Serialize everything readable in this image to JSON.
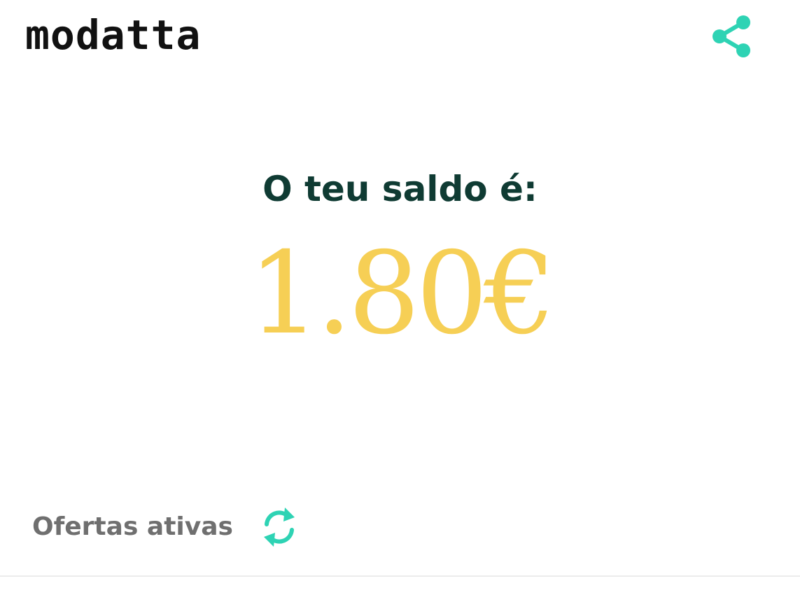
{
  "header": {
    "logo_text": "modatta",
    "share_icon": "share-icon"
  },
  "balance": {
    "label": "O teu saldo é:",
    "amount": "1.80€"
  },
  "offers": {
    "title": "Ofertas ativas",
    "refresh_icon": "refresh-icon"
  },
  "colors": {
    "brand_teal": "#2ed3b4",
    "heading_dark": "#0f3b33",
    "amount_yellow": "#f6cf55",
    "muted_gray": "#6f6f6f"
  }
}
